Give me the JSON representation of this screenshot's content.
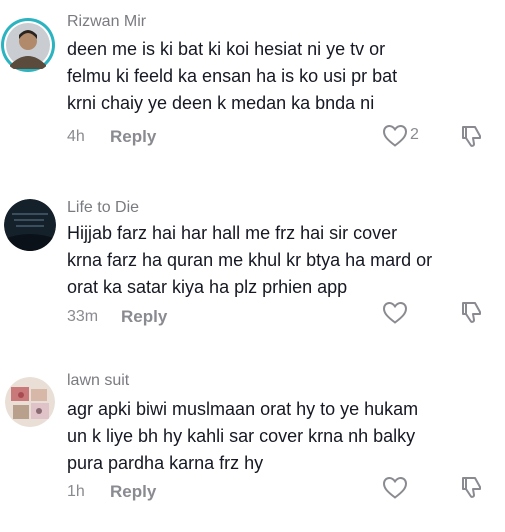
{
  "comments": [
    {
      "username": "Rizwan Mir",
      "lines": [
        "deen me is ki bat ki koi hesiat ni ye tv or",
        "felmu ki feeld ka ensan ha is ko usi pr bat",
        "krni chaiy ye deen k medan ka bnda ni"
      ],
      "time": "4h",
      "reply_label": "Reply",
      "like_count": "2"
    },
    {
      "username": "Life to Die",
      "lines": [
        "Hijjab farz hai har hall me frz hai sir cover",
        "krna farz ha quran me khul kr btya ha mard or",
        "orat ka satar kiya ha plz prhien app"
      ],
      "time": "33m",
      "reply_label": "Reply",
      "like_count": ""
    },
    {
      "username": "lawn suit",
      "lines": [
        "agr apki biwi muslmaan orat hy to ye hukam",
        "un k liye bh hy kahli sar cover krna nh balky",
        "pura pardha karna frz hy"
      ],
      "time": "1h",
      "reply_label": "Reply",
      "like_count": ""
    }
  ],
  "icons": {
    "like": "heart-outline-icon",
    "dislike": "thumbs-down-outline-icon"
  },
  "colors": {
    "text": "#161823",
    "muted": "#8a8b91",
    "avatar_ring": "#2bb3c0"
  }
}
